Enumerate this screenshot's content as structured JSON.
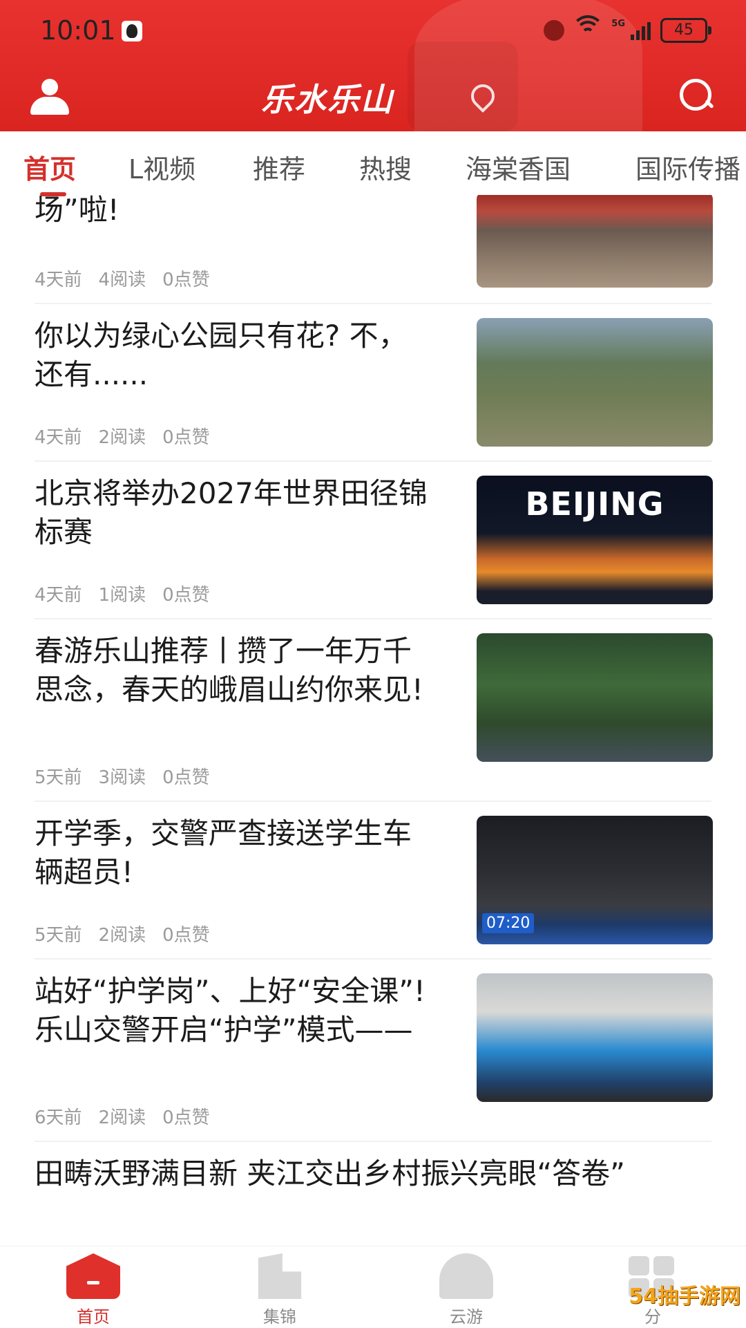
{
  "status_bar": {
    "time": "10:01",
    "signal": "5G",
    "battery": "45"
  },
  "header": {
    "logo_text": "乐水乐山"
  },
  "tabs": [
    {
      "label": "首页",
      "active": true
    },
    {
      "label": "L视频"
    },
    {
      "label": "推荐"
    },
    {
      "label": "热搜"
    },
    {
      "label": "海棠香国"
    },
    {
      "label": "国际传播"
    }
  ],
  "feed": [
    {
      "title": "场”啦!",
      "time": "4天前",
      "reads": "4阅读",
      "likes": "0点赞",
      "image": "crowd-dining"
    },
    {
      "title": "你以为绿心公园只有花? 不，还有......",
      "time": "4天前",
      "reads": "2阅读",
      "likes": "0点赞",
      "image": "park"
    },
    {
      "title": "北京将举办2027年世界田径锦标赛",
      "time": "4天前",
      "reads": "1阅读",
      "likes": "0点赞",
      "image": "stadium",
      "image_text": "BEIJING"
    },
    {
      "title": "春游乐山推荐丨攒了一年万千思念，春天的峨眉山约你来见!",
      "time": "5天前",
      "reads": "3阅读",
      "likes": "0点赞",
      "image": "forest-road"
    },
    {
      "title": "开学季，交警严查接送学生车辆超员!",
      "time": "5天前",
      "reads": "2阅读",
      "likes": "0点赞",
      "image": "night-road",
      "image_text": "07:20"
    },
    {
      "title": "站好“护学岗”、上好“安全课”! 乐山交警开启“护学”模式——",
      "time": "6天前",
      "reads": "2阅读",
      "likes": "0点赞",
      "image": "school-kids"
    },
    {
      "title": "田畴沃野满目新 夹江交出乡村振兴亮眼“答卷”"
    }
  ],
  "bottom_nav": [
    {
      "label": "首页",
      "icon": "home-icon",
      "active": true
    },
    {
      "label": "集锦",
      "icon": "building-icon"
    },
    {
      "label": "云游",
      "icon": "mountain-icon"
    },
    {
      "label": "分",
      "icon": "apps-icon"
    }
  ],
  "watermark": "54抽手游网",
  "colors": {
    "brand_red": "#e0302b",
    "active_tab": "#d4302b",
    "meta_grey": "#9a9a9a"
  }
}
